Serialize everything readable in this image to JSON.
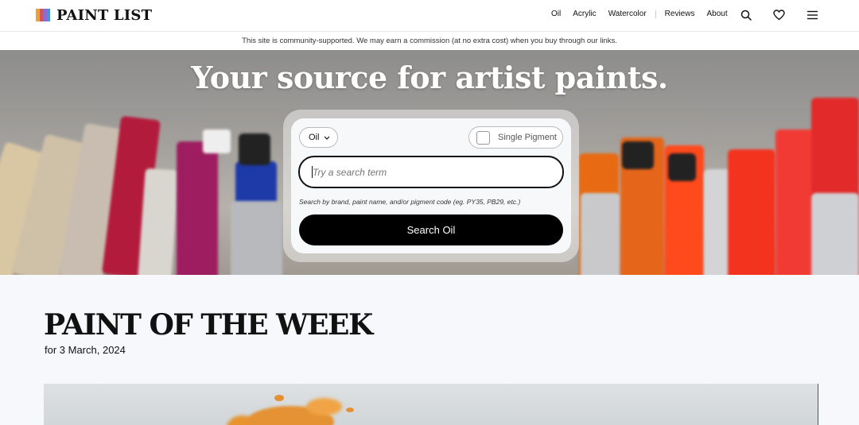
{
  "header": {
    "logo_text": "PAINT LIST",
    "logo_colors": [
      "#e8a23a",
      "#d9534f",
      "#8e6cc9",
      "#4a8fd8"
    ],
    "nav": [
      "Oil",
      "Acrylic",
      "Watercolor",
      "Reviews",
      "About"
    ],
    "icons": [
      "search-icon",
      "heart-icon",
      "menu-icon"
    ]
  },
  "disclaimer": "This site is community-supported. We may earn a commission (at no extra cost) when you buy through our links.",
  "hero": {
    "title": "Your source for artist paints.",
    "medium_select": "Oil",
    "single_pigment_label": "Single Pigment",
    "search_placeholder": "Try a search term",
    "search_hint": "Search by brand, paint name, and/or pigment code (eg. PY35, PB29, etc.)",
    "search_button": "Search Oil"
  },
  "potw": {
    "title": "PAINT OF THE WEEK",
    "date": "for 3 March, 2024"
  }
}
